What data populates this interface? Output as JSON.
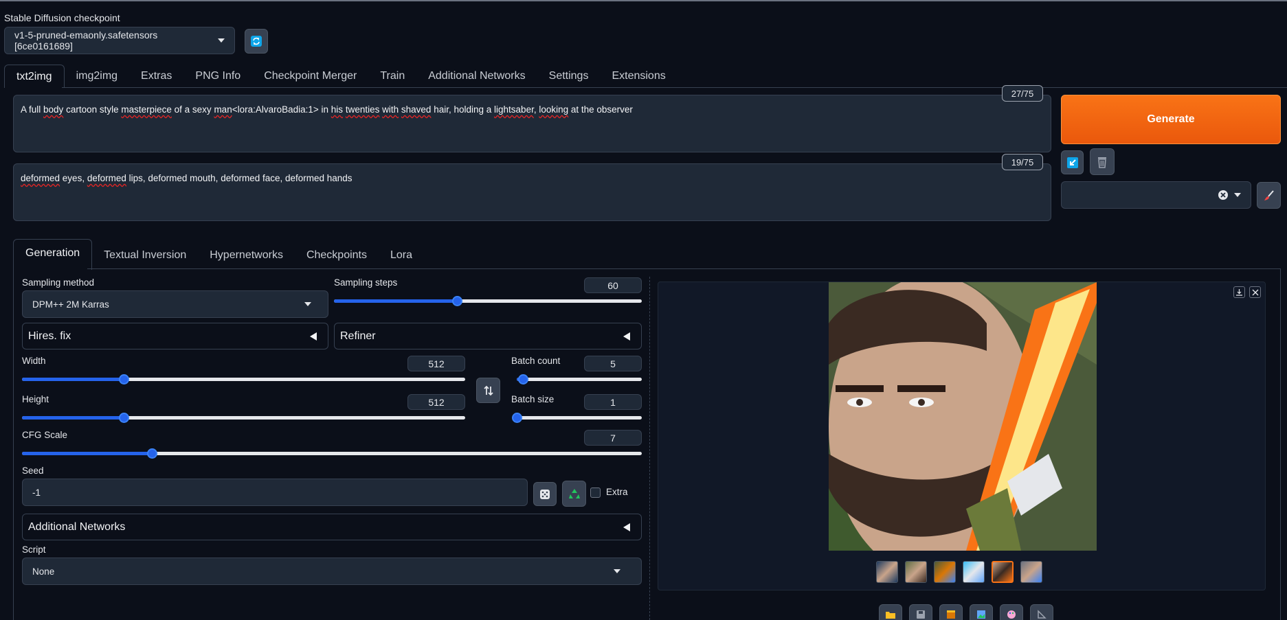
{
  "checkpoint": {
    "label": "Stable Diffusion checkpoint",
    "value": "v1-5-pruned-emaonly.safetensors [6ce0161689]",
    "refresh_icon": "refresh-icon"
  },
  "main_tabs": [
    "txt2img",
    "img2img",
    "Extras",
    "PNG Info",
    "Checkpoint Merger",
    "Train",
    "Additional Networks",
    "Settings",
    "Extensions"
  ],
  "prompt": {
    "positive": {
      "parts": [
        "A full ",
        "body",
        " cartoon style ",
        "masterpiece",
        " of a sexy ",
        "man",
        "<lora:AlvaroBadia:1> in ",
        "his",
        " ",
        "twenties",
        " ",
        "with",
        " ",
        "shaved",
        " hair, holding a ",
        "lightsaber",
        ",  ",
        "looking",
        " at the observer"
      ],
      "counter": "27/75"
    },
    "negative": {
      "parts": [
        "deformed",
        " eyes, ",
        "deformed",
        " lips, deformed mouth, deformed face, deformed hands"
      ],
      "counter": "19/75"
    }
  },
  "actions": {
    "generate_label": "Generate",
    "paste_icon": "arrow-down-left-icon",
    "trash_icon": "trash-icon",
    "style_clear_icon": "close-circle-icon",
    "brush_icon": "paintbrush-icon"
  },
  "sub_tabs": [
    "Generation",
    "Textual Inversion",
    "Hypernetworks",
    "Checkpoints",
    "Lora"
  ],
  "generation": {
    "sampling_method": {
      "label": "Sampling method",
      "value": "DPM++ 2M Karras"
    },
    "sampling_steps": {
      "label": "Sampling steps",
      "value": "60",
      "fraction": 0.4
    },
    "hires_label": "Hires. fix",
    "refiner_label": "Refiner",
    "width": {
      "label": "Width",
      "value": "512",
      "fraction": 0.23
    },
    "height": {
      "label": "Height",
      "value": "512",
      "fraction": 0.23
    },
    "batch_count": {
      "label": "Batch count",
      "value": "5",
      "fraction": 0.05
    },
    "batch_size": {
      "label": "Batch size",
      "value": "1",
      "fraction": 0.0
    },
    "cfg_scale": {
      "label": "CFG Scale",
      "value": "7",
      "fraction": 0.21
    },
    "seed": {
      "label": "Seed",
      "value": "-1",
      "extra_label": "Extra"
    },
    "additional_networks_label": "Additional Networks",
    "script": {
      "label": "Script",
      "value": "None"
    }
  },
  "colors": {
    "accent": "#2563eb",
    "generate": "#f97316",
    "background": "#0b0f19"
  }
}
